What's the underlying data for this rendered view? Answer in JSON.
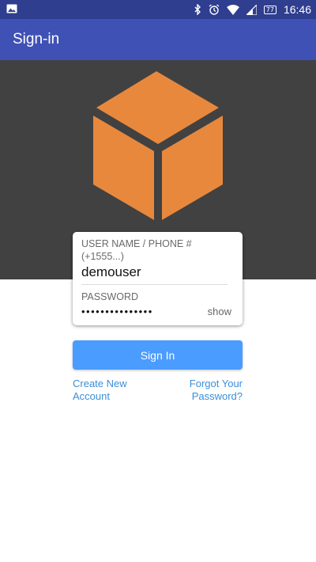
{
  "status_bar": {
    "time": "16:46",
    "battery": "77",
    "icons": [
      "image-icon",
      "bluetooth-icon",
      "alarm-icon",
      "wifi-icon",
      "signal-icon",
      "battery-icon"
    ]
  },
  "app_bar": {
    "title": "Sign-in"
  },
  "logo": {
    "icon": "cube-icon",
    "color": "#e8883d"
  },
  "form": {
    "username_label": "USER NAME / PHONE # (+1555...)",
    "username_value": "demouser",
    "password_label": "PASSWORD",
    "password_masked": "•••••••••••••••",
    "show_label": "show"
  },
  "actions": {
    "signin_label": "Sign In",
    "create_account": "Create New Account",
    "forgot_password": "Forgot Your Password?"
  },
  "colors": {
    "status_bar": "#2f3e8f",
    "app_bar": "#3f51b5",
    "hero": "#414141",
    "button": "#4a9cff",
    "link": "#3b8ed8"
  }
}
